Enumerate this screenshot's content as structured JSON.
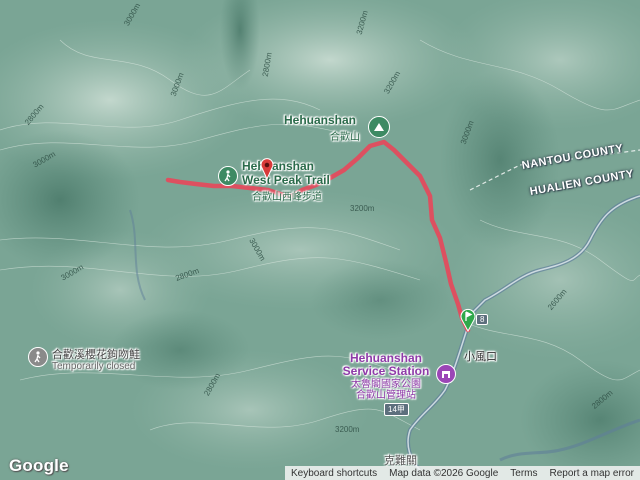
{
  "peaks": {
    "hehuanshan_name": "Hehuanshan",
    "hehuanshan_zh": "合歡山",
    "west_peak_name_1": "Hehuanshan",
    "west_peak_name_2": "West Peak Trail",
    "west_peak_zh": "合歡山西峰步道"
  },
  "counties": {
    "nantou": "NANTOU COUNTY",
    "hualien": "HUALIEN COUNTY"
  },
  "poi": {
    "cherry_trail": "合歡溪櫻花鉤吻鮭",
    "cherry_status": "Temporarily closed",
    "station_1": "Hehuanshan",
    "station_2": "Service Station",
    "station_zh_1": "太魯閣國家公園",
    "station_zh_2": "合歡山管理站",
    "xiaofengkou": "小風口",
    "kexiongguan": "克難關",
    "road_14": "14甲"
  },
  "elevations": {
    "e1": "3000m",
    "e2": "2800m",
    "e3": "2800m",
    "e4": "3000m",
    "e5": "3200m",
    "e6": "3000m",
    "e7": "3000m",
    "e8": "2800m",
    "e9": "3200m",
    "e10": "3000m",
    "e11": "3200m",
    "e12": "2800m",
    "e13": "3000m",
    "e14": "2600m",
    "e15": "3200m",
    "e16": "2800m"
  },
  "footer": {
    "shortcuts": "Keyboard shortcuts",
    "mapdata": "Map data ©2026 Google",
    "terms": "Terms",
    "report": "Report a map error"
  },
  "brand": {
    "logo": "Google"
  },
  "colors": {
    "route": "#e8475a",
    "terrain": "#6f9a8c",
    "start_marker": "#2fa84a",
    "end_marker": "#d93a3a"
  },
  "icons": [
    "hiker-icon",
    "mountain-peak-icon",
    "start-flag-icon",
    "end-pin-icon",
    "service-station-icon",
    "road-sign-icon"
  ]
}
